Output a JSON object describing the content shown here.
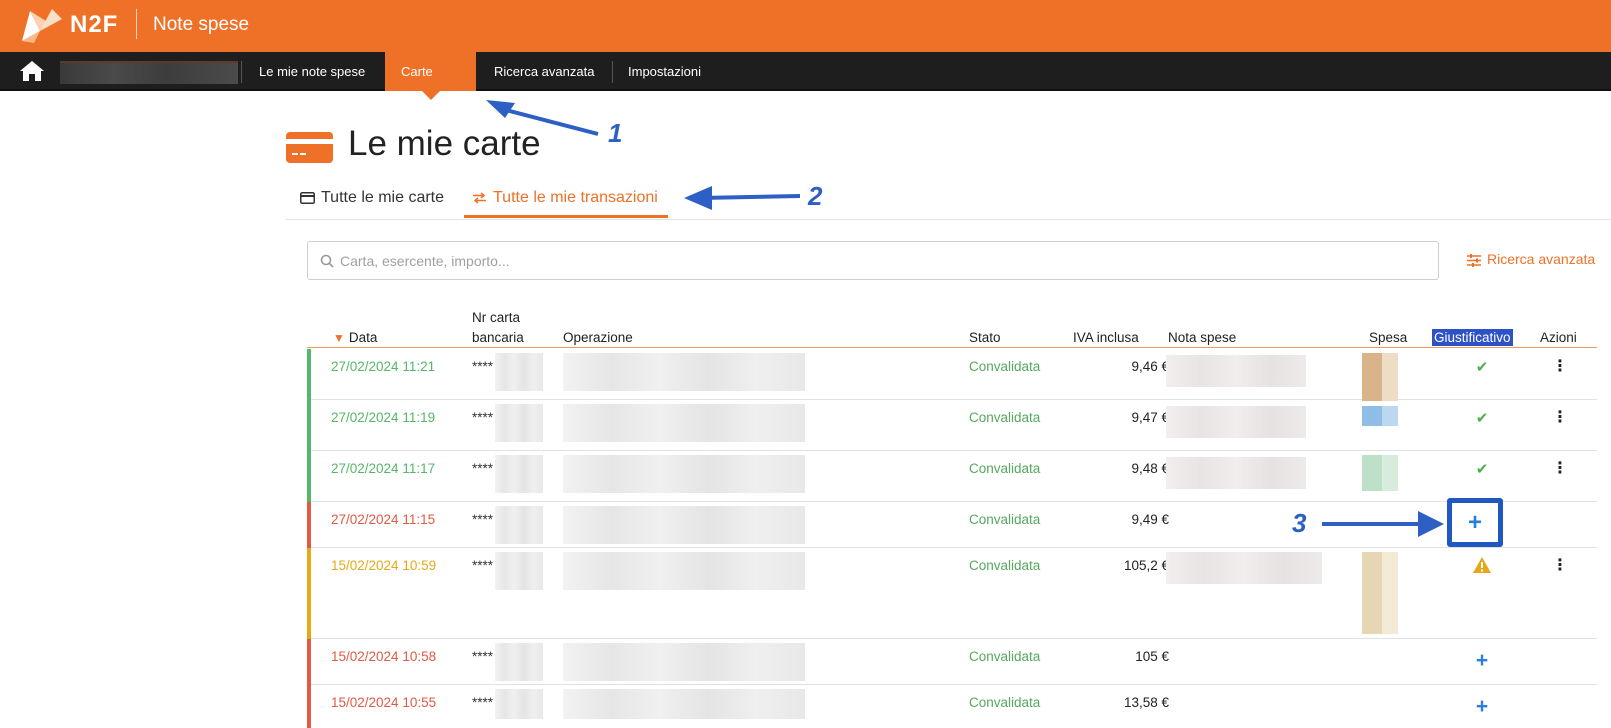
{
  "header": {
    "brand": "N2F",
    "app_title": "Note spese",
    "brand_color": "#ee7127"
  },
  "nav": {
    "items": [
      {
        "label": "Le mie note spese",
        "active": false
      },
      {
        "label": "Carte N2F",
        "active": true
      },
      {
        "label": "Ricerca avanzata",
        "active": false
      },
      {
        "label": "Impostazioni",
        "active": false
      }
    ]
  },
  "page": {
    "title": "Le mie carte"
  },
  "tabs": [
    {
      "label": "Tutte le mie carte",
      "icon": "credit-card-icon",
      "active": false
    },
    {
      "label": "Tutte le mie transazioni",
      "icon": "transfer-arrows-icon",
      "active": true
    }
  ],
  "search": {
    "placeholder": "Carta, esercente, importo...",
    "value": "",
    "advanced_label": "Ricerca avanzata"
  },
  "table": {
    "columns": {
      "date": "Data",
      "card_line1": "Nr carta",
      "card_line2": "bancaria",
      "operation": "Operazione",
      "status": "Stato",
      "vat": "IVA inclusa",
      "expense_note": "Nota spese",
      "expense": "Spesa",
      "receipt": "Giustificativo",
      "actions": "Azioni"
    },
    "sort": {
      "column": "Data",
      "direction": "descending"
    },
    "rows": [
      {
        "date": "27/02/2024 11:21",
        "card": "****",
        "status": "Convalidata",
        "amount": "9,46 €",
        "receipt": "check",
        "state_color": "#55b767",
        "has_actions": true
      },
      {
        "date": "27/02/2024 11:19",
        "card": "****",
        "status": "Convalidata",
        "amount": "9,47 €",
        "receipt": "check",
        "state_color": "#55b767",
        "has_actions": true
      },
      {
        "date": "27/02/2024 11:17",
        "card": "****",
        "status": "Convalidata",
        "amount": "9,48 €",
        "receipt": "check",
        "state_color": "#55b767",
        "has_actions": true
      },
      {
        "date": "27/02/2024 11:15",
        "card": "****",
        "status": "Convalidata",
        "amount": "9,49 €",
        "receipt": "add",
        "state_color": "#e05a44",
        "has_actions": false
      },
      {
        "date": "15/02/2024 10:59",
        "card": "****",
        "status": "Convalidata",
        "amount": "105,2 €",
        "receipt": "warning",
        "state_color": "#e6a817",
        "has_actions": true
      },
      {
        "date": "15/02/2024 10:58",
        "card": "****",
        "status": "Convalidata",
        "amount": "105 €",
        "receipt": "add",
        "state_color": "#e05a44",
        "has_actions": false
      },
      {
        "date": "15/02/2024 10:55",
        "card": "****",
        "status": "Convalidata",
        "amount": "13,58 €",
        "receipt": "add",
        "state_color": "#e05a44",
        "has_actions": false
      }
    ]
  },
  "annotations": {
    "one": "1",
    "two": "2",
    "three": "3"
  }
}
